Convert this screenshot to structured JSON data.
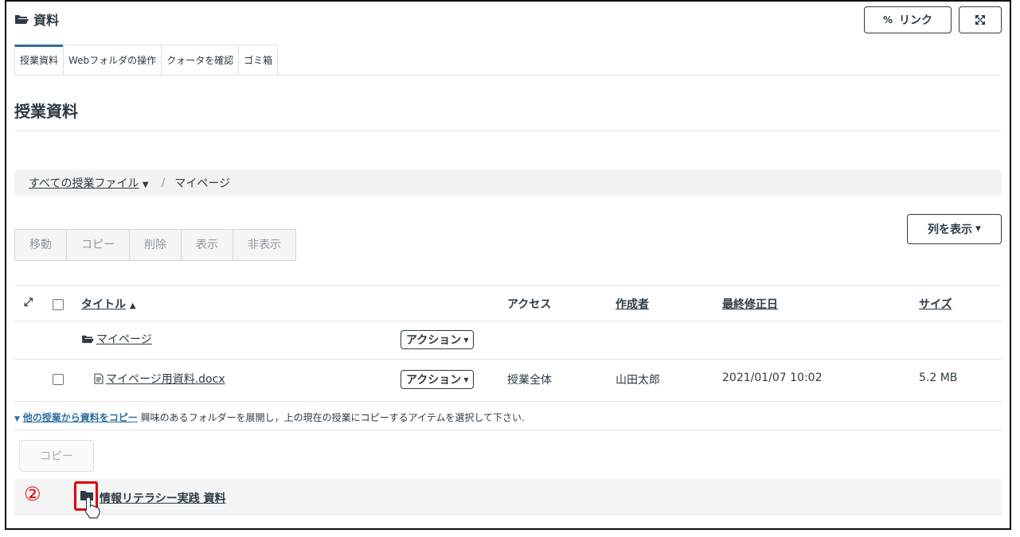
{
  "header": {
    "title": "資料",
    "link_button": "リンク",
    "link_icon": "🔗",
    "fullscreen_icon": "⤢"
  },
  "tabs": [
    {
      "label": "授業資料",
      "active": true
    },
    {
      "label": "Webフォルダの操作",
      "active": false
    },
    {
      "label": "クォータを確認",
      "active": false
    },
    {
      "label": "ゴミ箱",
      "active": false
    }
  ],
  "page_title": "授業資料",
  "breadcrumb": {
    "root": "すべての授業ファイル",
    "separator": "/",
    "current": "マイページ"
  },
  "column_button": "列を表示",
  "toolbar": [
    "移動",
    "コピー",
    "削除",
    "表示",
    "非表示"
  ],
  "table": {
    "headers": {
      "title": "タイトル",
      "access": "アクセス",
      "author": "作成者",
      "modified": "最終修正日",
      "size": "サイズ"
    },
    "rows": [
      {
        "type": "folder",
        "title": "マイページ",
        "action": "アクション",
        "access": "",
        "author": "",
        "modified": "",
        "size": ""
      },
      {
        "type": "file",
        "title": "マイページ用資料.docx",
        "action": "アクション",
        "access": "授業全体",
        "author": "山田太郎",
        "modified": "2021/01/07 10:02",
        "size": "5.2 MB"
      }
    ]
  },
  "copy_section": {
    "link": "他の授業から資料をコピー",
    "description": "興味のあるフォルダーを展開し，上の現在の授業にコピーするアイテムを選択して下さい.",
    "copy_button": "コピー",
    "folder_title": "情報リテラシー実践 資料",
    "step_marker": "②"
  },
  "colors": {
    "text": "#2d3b45",
    "highlight_red": "#e00000",
    "tab_accent": "#2d6fa0"
  }
}
